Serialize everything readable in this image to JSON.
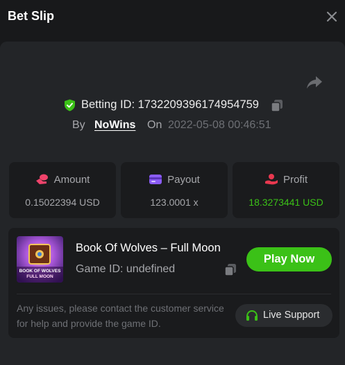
{
  "header": {
    "title": "Bet Slip",
    "close_icon": "close-icon"
  },
  "bet": {
    "betting_id_label": "Betting ID: 1732209396174954759",
    "by_label": "By",
    "user": "NoWins",
    "on_label": "On",
    "datetime": "2022-05-08 00:46:51"
  },
  "stats": {
    "amount": {
      "label": "Amount",
      "value": "0.15022394 USD",
      "icon": "coin-icon",
      "icon_color": "#f0436b"
    },
    "payout": {
      "label": "Payout",
      "value": "123.0001 x",
      "icon": "card-icon",
      "icon_color": "#8b5cf6"
    },
    "profit": {
      "label": "Profit",
      "value": "18.3273441 USD",
      "icon": "hand-coin-icon",
      "icon_color": "#e8384f",
      "value_color": "#3bc117"
    }
  },
  "game": {
    "name": "Book Of Wolves – Full Moon",
    "id_label": "Game ID: undefined",
    "thumb_text_line1": "BOOK OF WOLVES",
    "thumb_text_line2": "FULL MOON",
    "play_label": "Play Now",
    "help_text": "Any issues, please contact the customer service for help and provide the game ID.",
    "support_label": "Live Support"
  },
  "colors": {
    "accent_green": "#3bc117",
    "verified_green": "#3bc117"
  }
}
